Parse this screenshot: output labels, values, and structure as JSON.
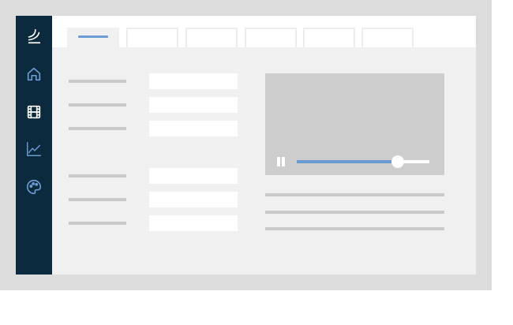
{
  "sidebar": {
    "items": [
      {
        "icon": "brand-logo-icon",
        "color": "#ffffff"
      },
      {
        "icon": "home-icon",
        "color": "#6b9bd2"
      },
      {
        "icon": "film-icon",
        "color": "#ffffff"
      },
      {
        "icon": "line-chart-icon",
        "color": "#6b9bd2"
      },
      {
        "icon": "palette-icon",
        "color": "#6b9bd2"
      }
    ]
  },
  "tabs": {
    "count": 6,
    "active_index": 0
  },
  "form": {
    "field_count": 6
  },
  "video_player": {
    "state": "paused",
    "progress": 0.76
  },
  "colors": {
    "sidebar_bg": "#0c2a3d",
    "accent": "#6b9bd2",
    "window_bg": "#f0f0f0",
    "frame_bg": "#dcdcdc"
  }
}
